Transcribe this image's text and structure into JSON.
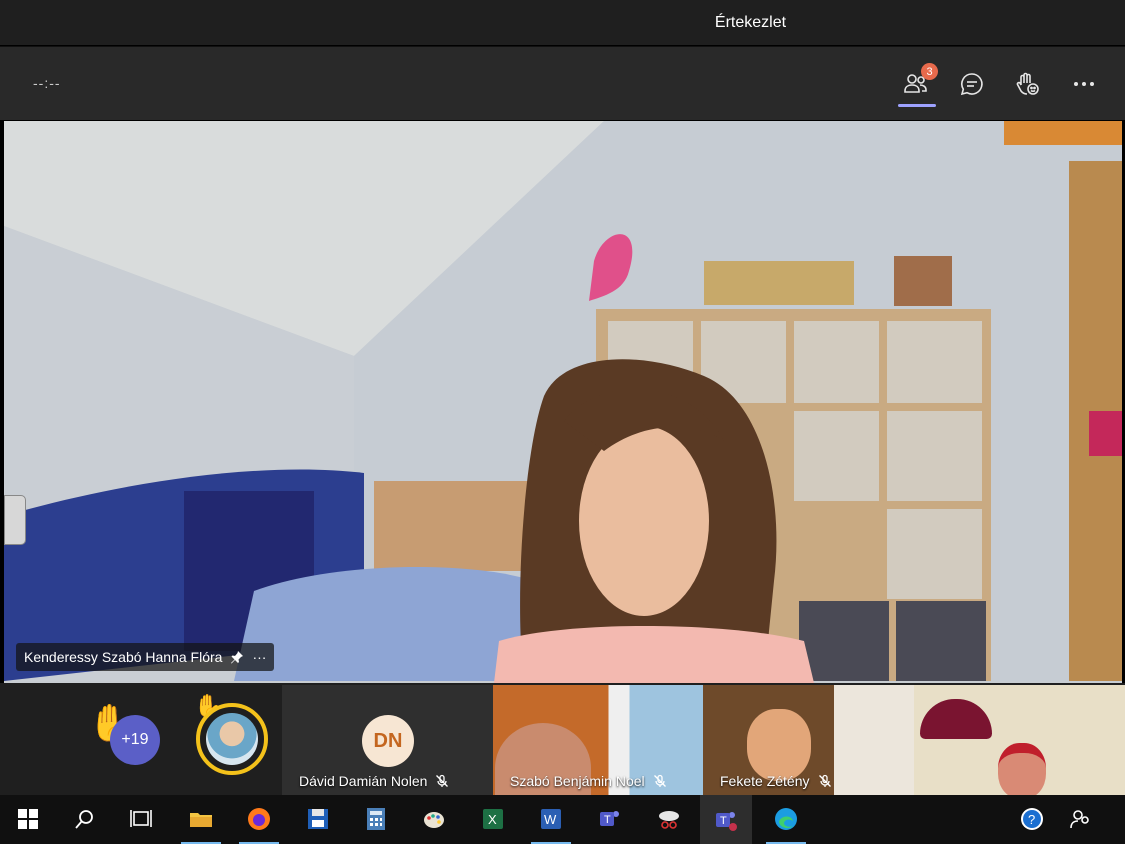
{
  "window": {
    "title": "Értekezlet"
  },
  "toolbar": {
    "timer": "--:--",
    "people_badge": "3",
    "icons": [
      "people-icon",
      "chat-icon",
      "reactions-icon",
      "more-icon"
    ]
  },
  "stage": {
    "pinned_name": "Kenderessy Szabó Hanna Flóra",
    "name_menu": "···"
  },
  "strip": {
    "raised_hands_count": "+19",
    "participants": [
      {
        "initials": "DN",
        "name": "Dávid Damián Nolen"
      },
      {
        "name": "Szabó Benjámin Noel"
      },
      {
        "name": "Fekete Zétény"
      }
    ]
  },
  "taskbar": {
    "apps": [
      "windows-start",
      "search",
      "task-view",
      "file-explorer",
      "firefox",
      "save",
      "calculator",
      "paint",
      "excel",
      "word",
      "teams",
      "snipping",
      "teams-active",
      "edge"
    ],
    "tray": [
      "help-icon",
      "people-icon"
    ]
  },
  "colors": {
    "accent": "#9ea2ff",
    "badge": "#e86a4c",
    "raise_hand_ring": "#f4c21b",
    "more_circle": "#5b5fc7"
  }
}
